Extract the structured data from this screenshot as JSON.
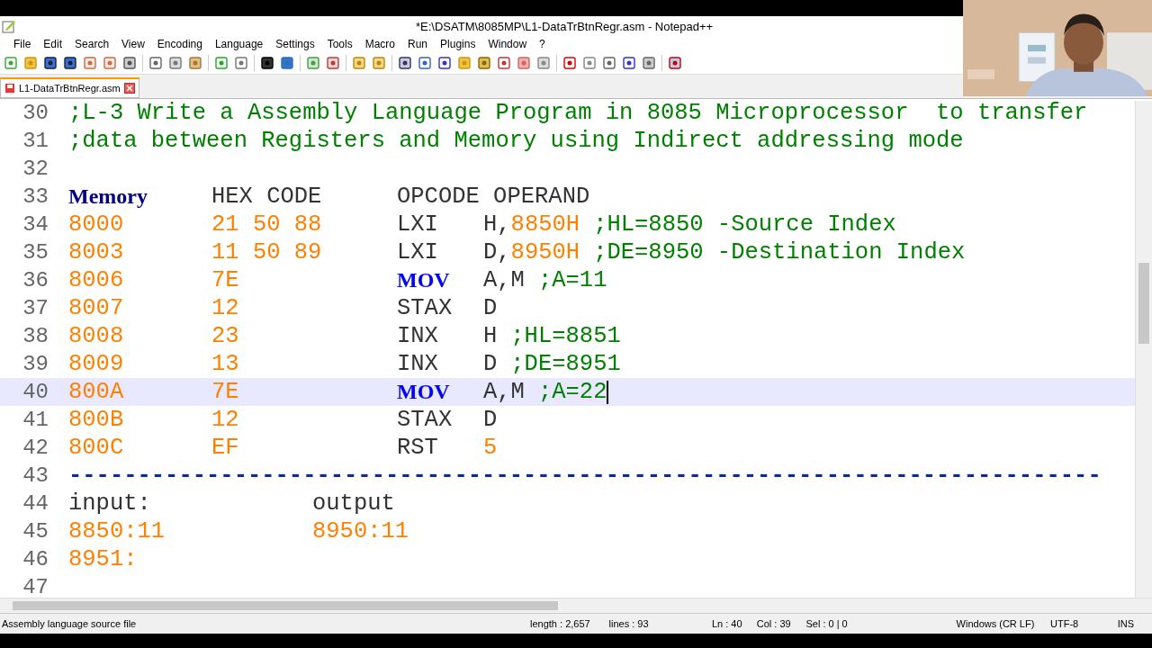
{
  "window": {
    "title": "*E:\\DSATM\\8085MP\\L1-DataTrBtnRegr.asm - Notepad++"
  },
  "menu": [
    "File",
    "Edit",
    "Search",
    "View",
    "Encoding",
    "Language",
    "Settings",
    "Tools",
    "Macro",
    "Run",
    "Plugins",
    "Window",
    "?"
  ],
  "tabs": [
    {
      "label": "L1-DataTrBtnRegr.asm",
      "selected": true
    }
  ],
  "editor": {
    "lines": [
      {
        "n": "30",
        "kind": "comment",
        "text": ";L-3 Write a Assembly Language Program in 8085 Microprocessor  to transfer",
        "current": false
      },
      {
        "n": "31",
        "kind": "comment",
        "text": ";data between Registers and Memory using Indirect addressing mode",
        "current": false
      },
      {
        "n": "32",
        "kind": "blank",
        "current": false
      },
      {
        "n": "33",
        "kind": "header",
        "cols": [
          "Memory",
          "HEX CODE",
          "OPCODE OPERAND"
        ],
        "current": false
      },
      {
        "n": "34",
        "kind": "code",
        "address": "8000",
        "hex": "21 50 88",
        "opcode": "LXI",
        "keyword": false,
        "register": "H,",
        "value": "8850H",
        "comment": ";HL=8850 -Source Index",
        "current": false
      },
      {
        "n": "35",
        "kind": "code",
        "address": "8003",
        "hex": "11 50 89",
        "opcode": "LXI",
        "keyword": false,
        "register": "D,",
        "value": "8950H",
        "comment": ";DE=8950 -Destination Index",
        "current": false
      },
      {
        "n": "36",
        "kind": "code",
        "address": "8006",
        "hex": "7E",
        "opcode": "MOV",
        "keyword": true,
        "register": "A,M",
        "comment": ";A=11",
        "current": false
      },
      {
        "n": "37",
        "kind": "code",
        "address": "8007",
        "hex": "12",
        "opcode": "STAX",
        "keyword": false,
        "register": "D",
        "current": false
      },
      {
        "n": "38",
        "kind": "code",
        "address": "8008",
        "hex": "23",
        "opcode": "INX",
        "keyword": false,
        "register": "H",
        "comment": ";HL=8851",
        "current": false
      },
      {
        "n": "39",
        "kind": "code",
        "address": "8009",
        "hex": "13",
        "opcode": "INX",
        "keyword": false,
        "register": "D",
        "comment": ";DE=8951",
        "current": false
      },
      {
        "n": "40",
        "kind": "code",
        "address": "800A",
        "hex": "7E",
        "opcode": "MOV",
        "keyword": true,
        "register": "A,M",
        "comment": ";A=22",
        "current": true
      },
      {
        "n": "41",
        "kind": "code",
        "address": "800B",
        "hex": "12",
        "opcode": "STAX",
        "keyword": false,
        "register": "D",
        "current": false
      },
      {
        "n": "42",
        "kind": "code",
        "address": "800C",
        "hex": "EF",
        "opcode": "RST",
        "keyword": false,
        "value": "5",
        "current": false
      },
      {
        "n": "43",
        "kind": "rule",
        "text": "---------------------------------------------------------------------------",
        "current": false
      },
      {
        "n": "44",
        "kind": "io",
        "left": "input:",
        "right": "output",
        "current": false
      },
      {
        "n": "45",
        "kind": "io",
        "left": "8850:11",
        "right": "8950:11",
        "current": false
      },
      {
        "n": "46",
        "kind": "io",
        "left": "8951:",
        "current": false
      },
      {
        "n": "47",
        "kind": "blank",
        "current": false
      }
    ]
  },
  "status_bar": {
    "file_type": "Assembly language source file",
    "length": "length : 2,657",
    "lines": "lines : 93",
    "ln": "Ln : 40",
    "col": "Col : 39",
    "sel": "Sel : 0 | 0",
    "eol": "Windows (CR LF)",
    "encoding": "UTF-8",
    "mode": "INS"
  }
}
